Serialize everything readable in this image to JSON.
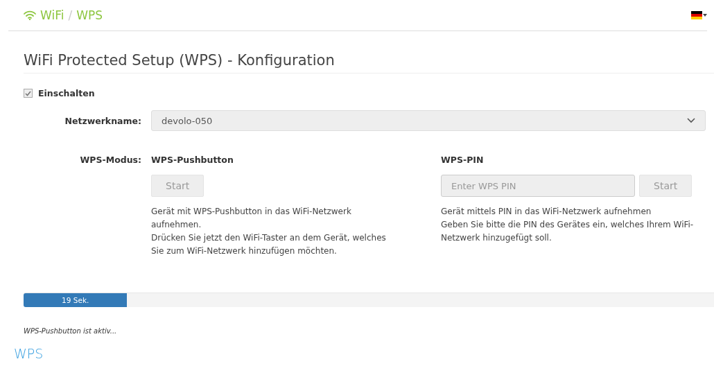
{
  "breadcrumb": [
    {
      "label": "WiFi"
    },
    {
      "label": "WPS"
    }
  ],
  "breadcrumb_separator": "/",
  "heading": "WiFi Protected Setup (WPS) - Konfiguration",
  "enable": {
    "label": "Einschalten",
    "checked": true
  },
  "network": {
    "label": "Netzwerkname:",
    "value": "devolo-050"
  },
  "mode": {
    "label": "WPS-Modus:",
    "pushbutton": {
      "title": "WPS-Pushbutton",
      "button": "Start",
      "description": [
        "Gerät mit WPS-Pushbutton in das WiFi-Netzwerk aufnehmen.",
        "Drücken Sie jetzt den WiFi-Taster an dem Gerät, welches Sie zum WiFi-Netzwerk hinzufügen möchten."
      ]
    },
    "pin": {
      "title": "WPS-PIN",
      "placeholder": "Enter WPS PIN",
      "button": "Start",
      "description": [
        "Gerät mittels PIN in das WiFi-Netzwerk aufnehmen",
        "Geben Sie bitte die PIN des Gerätes ein, welches Ihrem WiFi-Netzwerk hinzugefügt soll."
      ]
    }
  },
  "progress": {
    "level": 0.15,
    "reading": "19 Sek."
  },
  "status": "WPS-Pushbutton ist aktiv...",
  "footer_title": "WPS"
}
